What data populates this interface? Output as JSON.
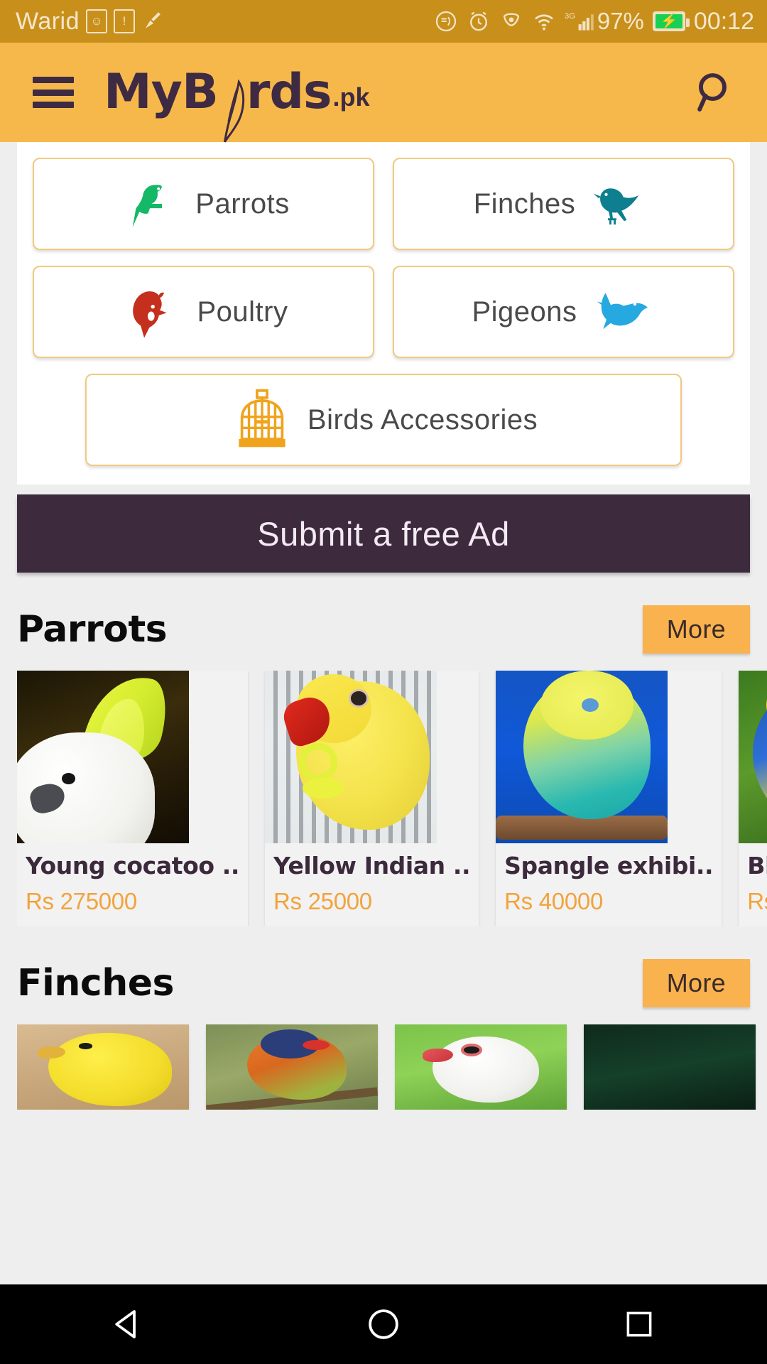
{
  "status_bar": {
    "carrier": "Warid",
    "battery_percent": "97%",
    "time": "00:12",
    "icons": [
      "smiley-face-icon",
      "warning-square-icon",
      "broom-icon",
      "do-not-disturb-icon",
      "alarm-clock-icon",
      "eye-care-icon",
      "wifi-icon",
      "signal-3g-icon"
    ],
    "network_type": "3G",
    "background_color": "#c8901a"
  },
  "header": {
    "menu_label": "Menu",
    "logo_part1": "MyB",
    "logo_part2": "rds",
    "logo_tld": ".pk",
    "search_label": "Search",
    "background_color": "#f7b84b",
    "logo_color": "#3e2a42"
  },
  "categories": [
    {
      "label": "Parrots",
      "icon": "parrot-icon",
      "icon_color": "#14b866",
      "icon_side": "left"
    },
    {
      "label": "Finches",
      "icon": "finch-icon",
      "icon_color": "#0d7f8f",
      "icon_side": "right"
    },
    {
      "label": "Poultry",
      "icon": "rooster-icon",
      "icon_color": "#c4301d",
      "icon_side": "left"
    },
    {
      "label": "Pigeons",
      "icon": "dove-icon",
      "icon_color": "#26a9e0",
      "icon_side": "right"
    },
    {
      "label": "Birds Accessories",
      "icon": "birdcage-icon",
      "icon_color": "#f0a31c",
      "icon_side": "left"
    }
  ],
  "submit_ad": {
    "label": "Submit a free Ad",
    "background_color": "#3d2b3d",
    "text_color": "#f4eaf3"
  },
  "sections": [
    {
      "title": "Parrots",
      "more_label": "More",
      "more_color": "#f9b24e",
      "items": [
        {
          "title": "Young cocatoo ..",
          "price": "Rs 275000",
          "photo": "p-cocatoo",
          "photo_alt": "white cockatoo with yellow crest"
        },
        {
          "title": "Yellow Indian ..",
          "price": "Rs 25000",
          "photo": "p-ringneck",
          "photo_alt": "yellow indian ringneck parrot with toy"
        },
        {
          "title": "Spangle exhibi..",
          "price": "Rs 40000",
          "photo": "p-budgie",
          "photo_alt": "spangle exhibition budgie on perch"
        },
        {
          "title": "Bl",
          "price": "Rs",
          "photo": "p-macaw",
          "photo_alt": "blue and gold macaw"
        }
      ]
    },
    {
      "title": "Finches",
      "more_label": "More",
      "more_color": "#f9b24e",
      "items": [
        {
          "title": "",
          "price": "",
          "photo": "p-canary",
          "photo_alt": "yellow canary"
        },
        {
          "title": "",
          "price": "",
          "photo": "p-gouldian",
          "photo_alt": "gouldian finch on branch"
        },
        {
          "title": "",
          "price": "",
          "photo": "p-java",
          "photo_alt": "white java sparrow"
        },
        {
          "title": "",
          "price": "",
          "photo": "p-dark",
          "photo_alt": "dark finch photo"
        }
      ]
    }
  ],
  "navbar": {
    "back_label": "Back",
    "home_label": "Home",
    "recents_label": "Recents",
    "background_color": "#000000"
  }
}
